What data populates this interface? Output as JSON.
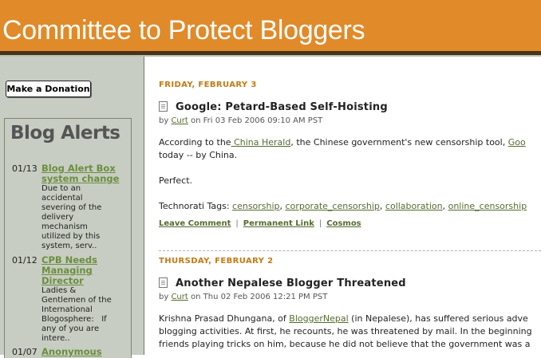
{
  "header": {
    "title": "Committee to Protect Bloggers"
  },
  "sidebar": {
    "donate_label": "Make a Donation",
    "alerts_title": "Blog Alerts",
    "alerts": [
      {
        "date": "01/13",
        "link_lines": [
          "Blog Alert Box",
          "system change"
        ],
        "desc_lines": [
          "Due to an",
          "accidental",
          "severing of the",
          "delivery",
          "mechanism",
          "utilized by this",
          "system, serv.."
        ]
      },
      {
        "date": "01/12",
        "link_lines": [
          "CPB Needs",
          "Managing",
          "Director"
        ],
        "desc_lines": [
          "Ladies &",
          "Gentlemen of the",
          "International",
          "Blogosphere:   If",
          "any of you are",
          "intere.."
        ]
      },
      {
        "date": "01/07",
        "link_lines": [
          "Anonymous"
        ],
        "desc_lines": []
      }
    ]
  },
  "posts": [
    {
      "date_heading": "FRIDAY, FEBRUARY 3",
      "title": "Google: Petard-Based Self-Hoisting",
      "by": "by",
      "author": "Curt",
      "posted": "on Fri 03 Feb 2006 09:10 AM PST",
      "line1_pre": "According to the",
      "line1_link": " China Herald",
      "line1_mid": ", the Chinese government's new censorship tool,",
      "line1_link2": "Goo",
      "line2": "today -- by China.",
      "line3": "Perfect.",
      "tags_label": "Technorati Tags:",
      "tags": [
        "censorship",
        "corporate_censorship",
        "collaboration",
        "online_censorship"
      ],
      "actions": [
        "Leave Comment",
        "Permanent Link",
        "Cosmos"
      ]
    },
    {
      "date_heading": "THURSDAY, FEBRUARY 2",
      "title": "Another Nepalese Blogger Threatened",
      "by": "by",
      "author": "Curt",
      "posted": "on Thu 02 Feb 2006 12:21 PM PST",
      "line1_pre": "Krishna Prasad Dhungana, of",
      "line1_link": "BloggerNepal",
      "line1_mid": "(in Nepalese), has suffered serious adve",
      "line2": "blogging activities. At first, he recounts, he was threatened by mail. In the beginning",
      "line3": "friends playing tricks on him, because he did not believe that the government was a"
    }
  ]
}
